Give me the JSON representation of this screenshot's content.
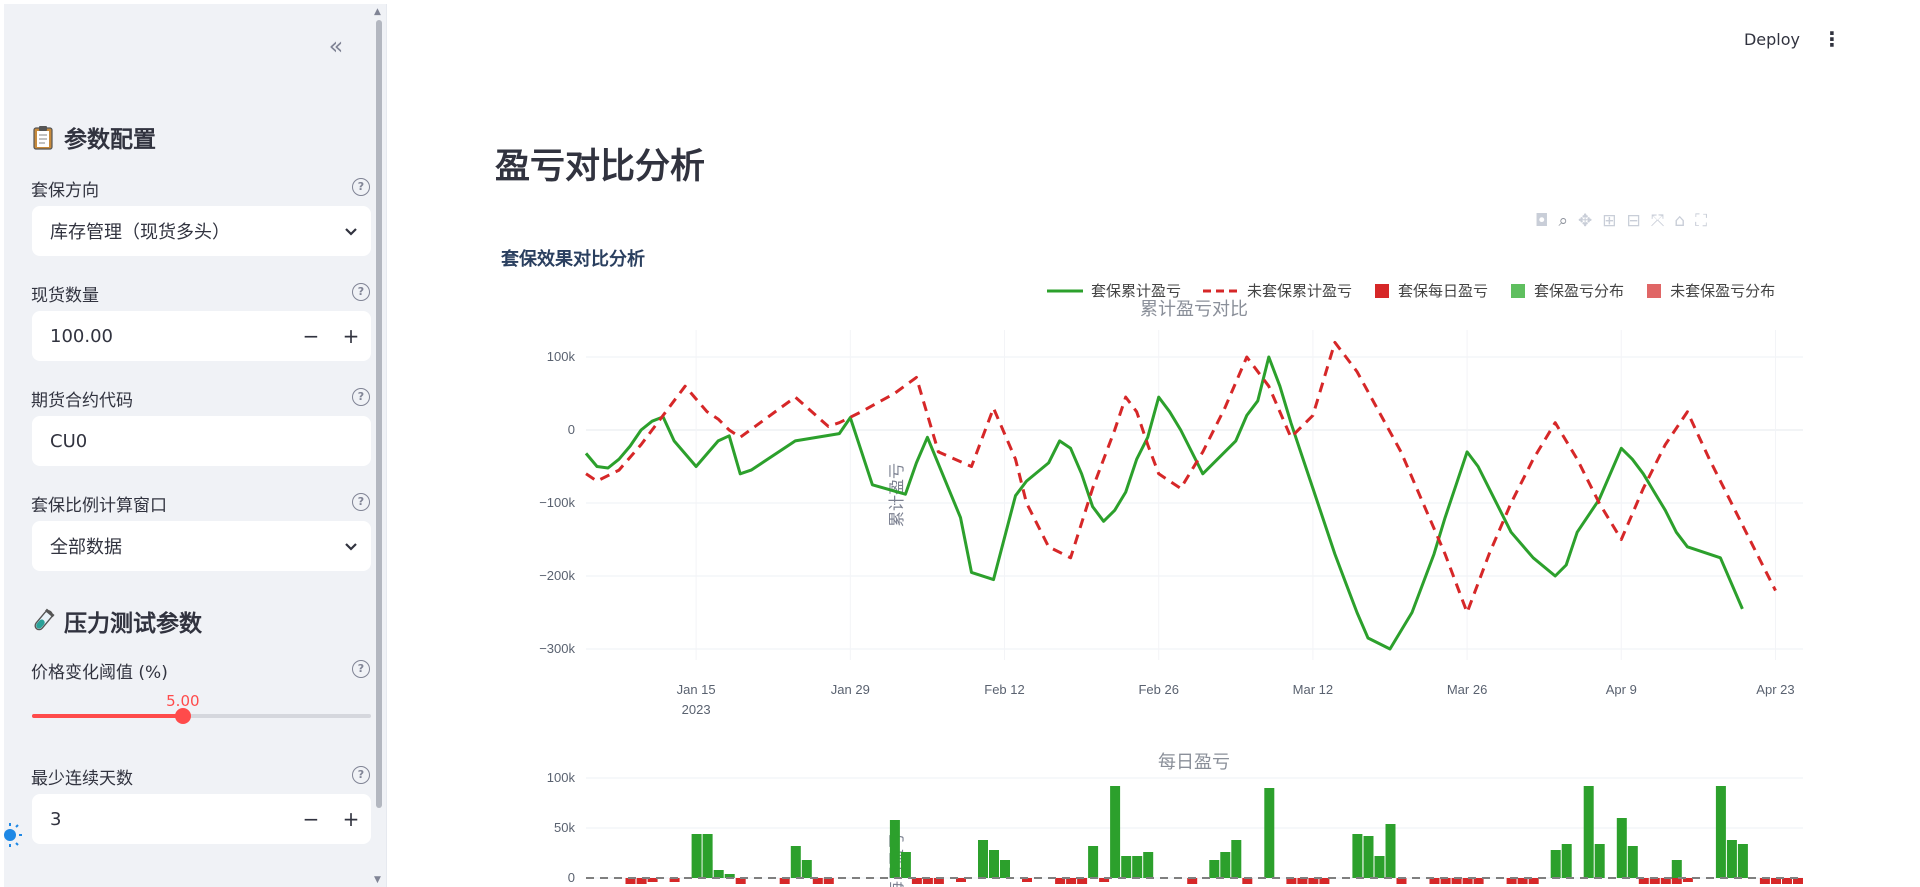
{
  "sidebar": {
    "collapse_icon": "«",
    "config_title": "参数配置",
    "hedge_direction": {
      "label": "套保方向",
      "value": "库存管理（现货多头）"
    },
    "spot_qty": {
      "label": "现货数量",
      "value": "100.00"
    },
    "contract_code": {
      "label": "期货合约代码",
      "value": "CU0"
    },
    "ratio_window": {
      "label": "套保比例计算窗口",
      "value": "全部数据"
    },
    "stress_title": "压力测试参数",
    "price_threshold": {
      "label": "价格变化阈值 (%)",
      "value": "5.00",
      "fraction": 0.445
    },
    "min_days": {
      "label": "最少连续天数",
      "value": "3"
    }
  },
  "header": {
    "deploy_label": "Deploy"
  },
  "main": {
    "page_title": "盈亏对比分析",
    "plot_title": "套保效果对比分析",
    "legend": [
      {
        "label": "套保累计盈亏",
        "kind": "line",
        "color": "#2ca02c"
      },
      {
        "label": "未套保累计盈亏",
        "kind": "dash",
        "color": "#d62728"
      },
      {
        "label": "套保每日盈亏",
        "kind": "box",
        "color": "#d62728"
      },
      {
        "label": "套保盈亏分布",
        "kind": "box",
        "color": "#5fbf5f"
      },
      {
        "label": "未套保盈亏分布",
        "kind": "box",
        "color": "#e06666"
      }
    ]
  },
  "chart_data": [
    {
      "type": "line",
      "title": "累计盈亏对比",
      "ylabel": "累计盈亏",
      "ylim": [
        -340000,
        130000
      ],
      "yticks": [
        100000,
        0,
        -100000,
        -200000,
        -300000
      ],
      "ytick_labels": [
        "100k",
        "0",
        "−100k",
        "−200k",
        "−300k"
      ],
      "xticks": [
        {
          "label": "Jan 15",
          "sub": "2023",
          "t": 6
        },
        {
          "label": "Jan 29",
          "t": 20
        },
        {
          "label": "Feb 12",
          "t": 34
        },
        {
          "label": "Feb 26",
          "t": 48
        },
        {
          "label": "Mar 12",
          "t": 62
        },
        {
          "label": "Mar 26",
          "t": 76
        },
        {
          "label": "Apr 9",
          "t": 90
        },
        {
          "label": "Apr 23",
          "t": 104
        }
      ],
      "x_range": [
        -4,
        106.5
      ],
      "series": [
        {
          "name": "套保累计盈亏",
          "color": "#2ca02c",
          "dash": false,
          "t": [
            -4,
            -3,
            -2,
            -1,
            0,
            1,
            2,
            3,
            4,
            6,
            8,
            9,
            10,
            11,
            15,
            19,
            20,
            22,
            25,
            26,
            27,
            30,
            31,
            33,
            35,
            36,
            38,
            39,
            40,
            41,
            42,
            43,
            44,
            45,
            46,
            47,
            48,
            49,
            50,
            52,
            55,
            56,
            57,
            58,
            59,
            60,
            61,
            62,
            64,
            65,
            66,
            67,
            69,
            71,
            73,
            74,
            75,
            76,
            77,
            78,
            80,
            82,
            84,
            85,
            86,
            88,
            90,
            91,
            92,
            93,
            94,
            95,
            96,
            99,
            101,
            102,
            103,
            104,
            105,
            106,
            106.5
          ],
          "y": [
            -32000,
            -50000,
            -52000,
            -40000,
            -22000,
            0,
            12000,
            18000,
            -15000,
            -50000,
            -15000,
            -8000,
            -60000,
            -55000,
            -15000,
            -5000,
            17000,
            -75000,
            -88000,
            -45000,
            -10000,
            -120000,
            -195000,
            -205000,
            -90000,
            -70000,
            -45000,
            -15000,
            -25000,
            -60000,
            -105000,
            -125000,
            -110000,
            -85000,
            -40000,
            -10000,
            45000,
            25000,
            0,
            -60000,
            -15000,
            20000,
            40000,
            100000,
            60000,
            10000,
            -35000,
            -80000,
            -170000,
            -210000,
            -250000,
            -285000,
            -300000,
            -250000,
            -170000,
            -120000,
            -75000,
            -30000,
            -50000,
            -80000,
            -140000,
            -175000,
            -200000,
            -185000,
            -140000,
            -95000,
            -25000,
            -40000,
            -60000,
            -85000,
            -110000,
            -140000,
            -160000,
            -175000,
            -245000
          ]
        },
        {
          "name": "未套保累计盈亏",
          "color": "#d62728",
          "dash": true,
          "t": [
            -4,
            -3,
            -1,
            1,
            2,
            3,
            5,
            7,
            8,
            9,
            10,
            15,
            18,
            19,
            21,
            24,
            26,
            28,
            31,
            33,
            35,
            36,
            38,
            40,
            42,
            44,
            45,
            46,
            47,
            48,
            50,
            52,
            54,
            56,
            58,
            60,
            62,
            64,
            66,
            70,
            72,
            74,
            76,
            78,
            80,
            82,
            84,
            86,
            88,
            90,
            92,
            94,
            96,
            98,
            100,
            102,
            104,
            106.5
          ],
          "y": [
            -60000,
            -70000,
            -55000,
            -20000,
            0,
            20000,
            60000,
            25000,
            15000,
            0,
            -10000,
            45000,
            5000,
            10000,
            25000,
            50000,
            72000,
            -30000,
            -50000,
            30000,
            -40000,
            -100000,
            -160000,
            -175000,
            -80000,
            0,
            45000,
            25000,
            -20000,
            -60000,
            -80000,
            -30000,
            30000,
            100000,
            60000,
            -10000,
            20000,
            120000,
            80000,
            -30000,
            -100000,
            -170000,
            -250000,
            -170000,
            -100000,
            -40000,
            10000,
            -40000,
            -100000,
            -150000,
            -80000,
            -20000,
            25000,
            -40000,
            -100000,
            -160000,
            -220000
          ]
        }
      ]
    },
    {
      "type": "bar",
      "title": "每日盈亏",
      "ylabel": "每日盈亏",
      "yticks": [
        100000,
        50000,
        0
      ],
      "ytick_labels": [
        "100k",
        "50k",
        "0"
      ],
      "green_bars": [
        [
          6,
          2,
          44000
        ],
        [
          7,
          1,
          18000
        ],
        [
          8,
          1,
          8000
        ],
        [
          9,
          1,
          4000
        ],
        [
          15,
          1,
          32000
        ],
        [
          16,
          1,
          18000
        ],
        [
          24,
          1,
          58000
        ],
        [
          25,
          1,
          26000
        ],
        [
          32,
          1,
          38000
        ],
        [
          33,
          1,
          28000
        ],
        [
          34,
          1,
          18000
        ],
        [
          42,
          1,
          32000
        ],
        [
          44,
          1,
          92000
        ],
        [
          45,
          1,
          22000
        ],
        [
          46,
          1,
          22000
        ],
        [
          47,
          1,
          26000
        ],
        [
          53,
          1,
          18000
        ],
        [
          54,
          1,
          26000
        ],
        [
          55,
          1,
          38000
        ],
        [
          58,
          1,
          90000
        ],
        [
          66,
          1,
          44000
        ],
        [
          67,
          1,
          42000
        ],
        [
          68,
          1,
          22000
        ],
        [
          69,
          1,
          54000
        ],
        [
          84,
          1,
          28000
        ],
        [
          85,
          1,
          34000
        ],
        [
          87,
          1,
          92000
        ],
        [
          88,
          1,
          34000
        ],
        [
          90,
          1,
          60000
        ],
        [
          91,
          1,
          32000
        ],
        [
          95,
          1,
          18000
        ],
        [
          99,
          1,
          92000
        ],
        [
          100,
          1,
          38000
        ],
        [
          101,
          1,
          34000
        ]
      ],
      "red_bars": [
        [
          0,
          2,
          -6000
        ],
        [
          2,
          1,
          -4000
        ],
        [
          4,
          1,
          -4000
        ],
        [
          10,
          1,
          -6000
        ],
        [
          14,
          1,
          -6000
        ],
        [
          17,
          2,
          -6000
        ],
        [
          26,
          3,
          -6000
        ],
        [
          30,
          1,
          -4000
        ],
        [
          36,
          1,
          -4000
        ],
        [
          39,
          3,
          -6000
        ],
        [
          43,
          1,
          -4000
        ],
        [
          51,
          1,
          -6000
        ],
        [
          56,
          1,
          -6000
        ],
        [
          60,
          4,
          -6000
        ],
        [
          70,
          1,
          -6000
        ],
        [
          73,
          5,
          -6000
        ],
        [
          80,
          3,
          -6000
        ],
        [
          92,
          4,
          -6000
        ],
        [
          96,
          1,
          -4000
        ],
        [
          103,
          4,
          -6000
        ]
      ]
    }
  ]
}
